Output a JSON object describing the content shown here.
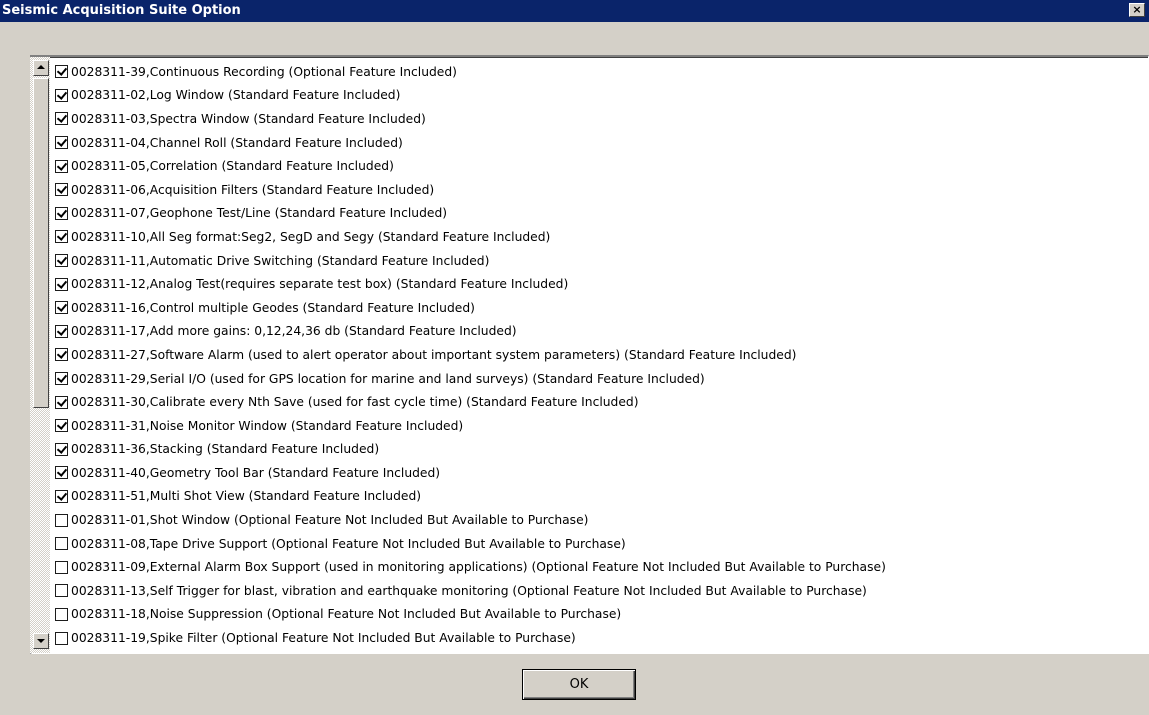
{
  "window": {
    "title": "Seismic Acquisition Suite Option",
    "close_glyph": "×"
  },
  "options": [
    {
      "label": "0028311-39,Continuous Recording (Optional Feature Included)",
      "checked": true
    },
    {
      "label": "0028311-02,Log Window (Standard Feature Included)",
      "checked": true
    },
    {
      "label": "0028311-03,Spectra Window (Standard Feature Included)",
      "checked": true
    },
    {
      "label": "0028311-04,Channel Roll (Standard Feature Included)",
      "checked": true
    },
    {
      "label": "0028311-05,Correlation (Standard Feature Included)",
      "checked": true
    },
    {
      "label": "0028311-06,Acquisition Filters (Standard Feature Included)",
      "checked": true
    },
    {
      "label": "0028311-07,Geophone Test/Line (Standard Feature Included)",
      "checked": true
    },
    {
      "label": "0028311-10,All Seg format:Seg2, SegD and Segy (Standard Feature Included)",
      "checked": true
    },
    {
      "label": "0028311-11,Automatic Drive Switching (Standard Feature Included)",
      "checked": true
    },
    {
      "label": "0028311-12,Analog Test(requires separate test box) (Standard Feature Included)",
      "checked": true
    },
    {
      "label": "0028311-16,Control multiple Geodes (Standard Feature Included)",
      "checked": true
    },
    {
      "label": "0028311-17,Add more gains: 0,12,24,36 db (Standard Feature Included)",
      "checked": true
    },
    {
      "label": "0028311-27,Software Alarm (used to alert operator about important system parameters) (Standard Feature Included)",
      "checked": true
    },
    {
      "label": "0028311-29,Serial I/O (used for GPS location for marine and land surveys) (Standard Feature Included)",
      "checked": true
    },
    {
      "label": "0028311-30,Calibrate every Nth Save (used for fast cycle time) (Standard Feature Included)",
      "checked": true
    },
    {
      "label": "0028311-31,Noise Monitor Window (Standard Feature Included)",
      "checked": true
    },
    {
      "label": "0028311-36,Stacking (Standard Feature Included)",
      "checked": true
    },
    {
      "label": "0028311-40,Geometry Tool Bar (Standard Feature Included)",
      "checked": true
    },
    {
      "label": "0028311-51,Multi Shot View (Standard Feature Included)",
      "checked": true
    },
    {
      "label": "0028311-01,Shot Window (Optional Feature Not Included But Available to Purchase)",
      "checked": false
    },
    {
      "label": "0028311-08,Tape Drive Support (Optional Feature Not Included But Available to Purchase)",
      "checked": false
    },
    {
      "label": "0028311-09,External Alarm Box Support (used in monitoring applications) (Optional Feature Not Included But Available to Purchase)",
      "checked": false
    },
    {
      "label": "0028311-13,Self Trigger for blast, vibration and earthquake monitoring (Optional Feature Not Included But Available to Purchase)",
      "checked": false
    },
    {
      "label": "0028311-18,Noise Suppression (Optional Feature Not Included But Available to Purchase)",
      "checked": false
    },
    {
      "label": "0028311-19,Spike Filter (Optional Feature Not Included But Available to Purchase)",
      "checked": false
    }
  ],
  "buttons": {
    "ok_label": "OK"
  },
  "icons": {
    "close": "close-icon",
    "scroll_up": "scroll-up-arrow-icon",
    "scroll_down": "scroll-down-arrow-icon",
    "checkbox": "checkbox-icon"
  },
  "colors": {
    "titlebar": "#0a246a",
    "face": "#d4d0c8",
    "list_bg": "#ffffff"
  }
}
